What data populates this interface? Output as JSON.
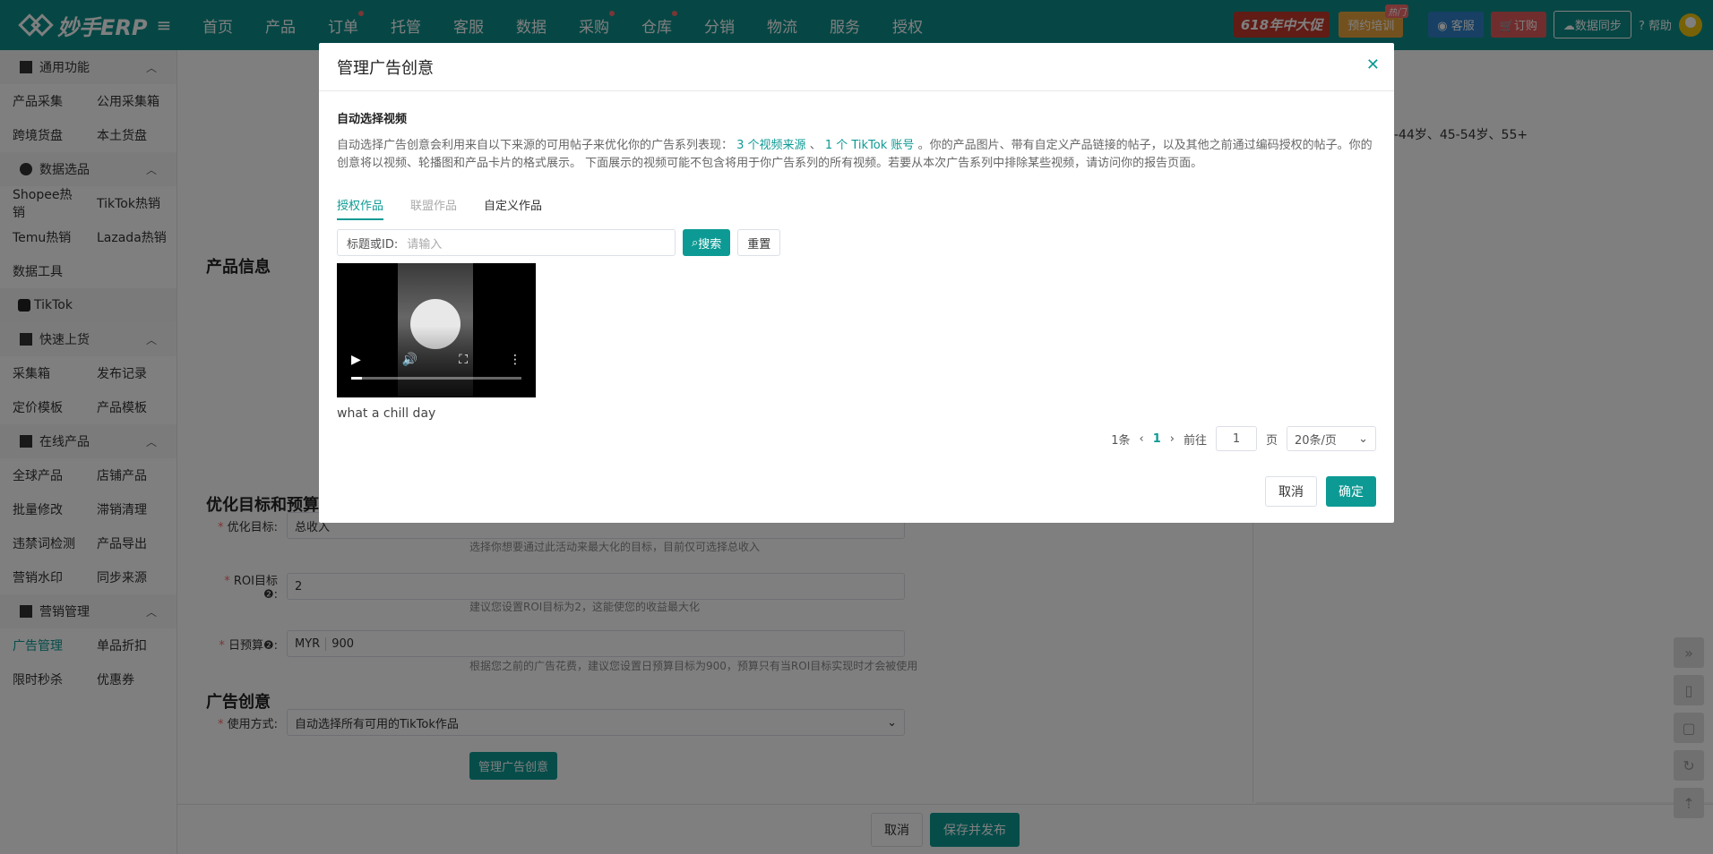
{
  "header": {
    "logo_text": "妙手ERP",
    "nav": [
      "首页",
      "产品",
      "订单",
      "托管",
      "客服",
      "数据",
      "采购",
      "仓库",
      "分销",
      "物流",
      "服务",
      "授权"
    ],
    "promo": "618年中大促",
    "training": "预约培训",
    "training_badge": "热门",
    "service": "客服",
    "order": "订购",
    "sync": "数据同步",
    "help": "帮助"
  },
  "sidebar": {
    "common": "通用功能",
    "common_items": [
      "产品采集",
      "公用采集箱",
      "跨境货盘",
      "本土货盘"
    ],
    "data": "数据选品",
    "data_items": [
      "Shopee热销",
      "TikTok热销",
      "Temu热销",
      "Lazada热销"
    ],
    "data_tools": "数据工具",
    "tiktok": "TikTok",
    "quick": "快速上货",
    "quick_items": [
      "采集箱",
      "发布记录",
      "定价模板",
      "产品模板"
    ],
    "online": "在线产品",
    "online_items": [
      "全球产品",
      "店铺产品",
      "批量修改",
      "滞销清理",
      "违禁词检测",
      "产品导出",
      "营销水印",
      "同步来源"
    ],
    "marketing": "营销管理",
    "marketing_items": [
      "广告管理",
      "单品折扣",
      "限时秒杀",
      "优惠券"
    ]
  },
  "page": {
    "product_info": "产品信息",
    "optimize_title": "优化目标和预算",
    "opt_label": "优化目标:",
    "opt_value": "总收入",
    "opt_hint": "选择你想要通过此活动来最大化的目标，目前仅可选择总收入",
    "roi_label": "ROI目标❷:",
    "roi_value": "2",
    "roi_hint": "建议您设置ROI目标为2，这能使您的收益最大化",
    "budget_label": "日预算❷:",
    "budget_currency": "MYR",
    "budget_value": "900",
    "budget_hint": "根据您之前的广告花费，建议您设置日预算目标为900，预算只有当ROI目标实现时才会被使用",
    "creative_title": "广告创意",
    "usage_label": "使用方式:",
    "usage_value": "自动选择所有可用的TikTok作品",
    "manage_btn": "管理广告创意",
    "age_text": "-44岁、45-54岁、55+",
    "cancel": "取消",
    "save_publish": "保存并发布"
  },
  "modal": {
    "title": "管理广告创意",
    "subtitle": "自动选择视频",
    "desc_pre": "自动选择广告创意会利用来自以下来源的可用帖子来优化你的广告系列表现：",
    "link1": "3 个视频来源",
    "sep": "、",
    "link2": "1 个 TikTok 账号",
    "desc_post": "。你的产品图片、带有自定义产品链接的帖子，以及其他之前通过编码授权的帖子。你的创意将以视频、轮播图和产品卡片的格式展示。 下面展示的视频可能不包含将用于你广告系列的所有视频。若要从本次广告系列中排除某些视频，请访问你的报告页面。",
    "tabs": [
      "授权作品",
      "联盟作品",
      "自定义作品"
    ],
    "search_label": "标题或ID:",
    "search_placeholder": "请输入",
    "search_btn": "搜索",
    "reset_btn": "重置",
    "video_title": "what a chill day",
    "total": "1条",
    "page": "1",
    "goto": "前往",
    "goto_page": "1",
    "page_unit": "页",
    "page_size": "20条/页",
    "cancel": "取消",
    "confirm": "确定"
  }
}
